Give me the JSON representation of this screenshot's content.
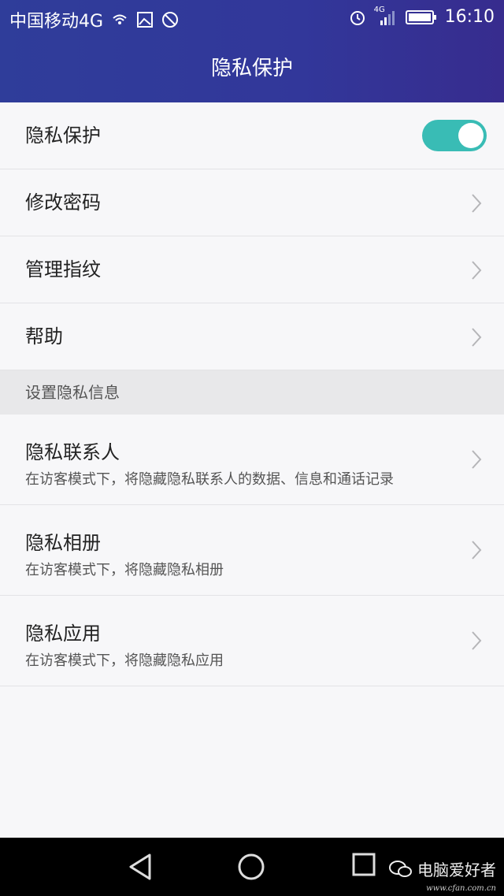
{
  "status_bar": {
    "carrier": "中国移动4G",
    "network_badge": "4G",
    "time": "16:10"
  },
  "header": {
    "title": "隐私保护"
  },
  "settings": {
    "privacy_toggle_label": "隐私保护",
    "privacy_toggle_on": true,
    "change_password": "修改密码",
    "manage_fingerprint": "管理指纹",
    "help": "帮助"
  },
  "section_header": "设置隐私信息",
  "privacy_items": [
    {
      "title": "隐私联系人",
      "subtitle": "在访客模式下，将隐藏隐私联系人的数据、信息和通话记录"
    },
    {
      "title": "隐私相册",
      "subtitle": "在访客模式下，将隐藏隐私相册"
    },
    {
      "title": "隐私应用",
      "subtitle": "在访客模式下，将隐藏隐私应用"
    }
  ],
  "watermark": {
    "text": "电脑爱好者",
    "url": "www.cfan.com.cn"
  },
  "colors": {
    "header": "#32379a",
    "toggle": "#39bcb5"
  }
}
